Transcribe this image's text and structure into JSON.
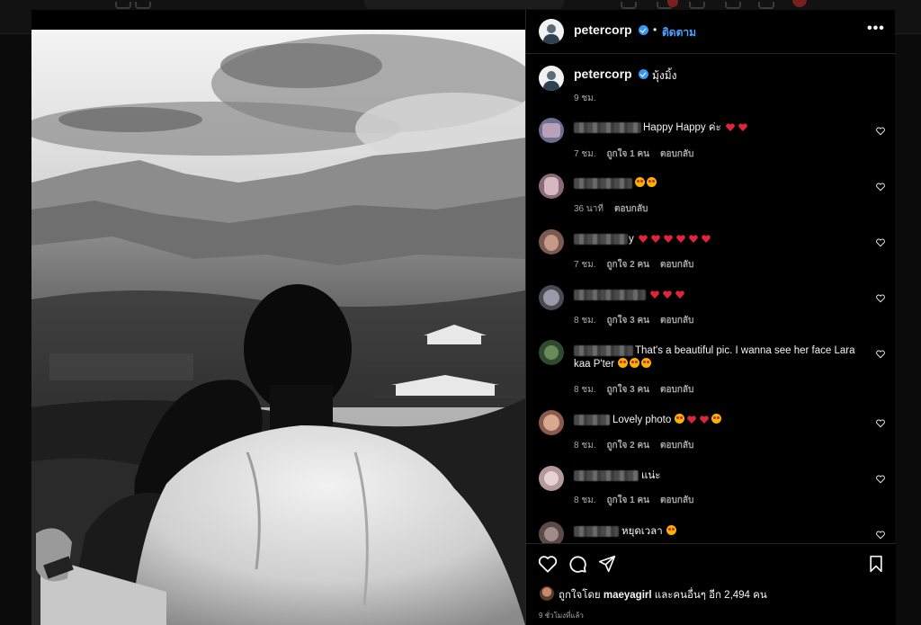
{
  "post": {
    "username": "petercorp",
    "dot": "•",
    "follow_label": "ติดตาม",
    "more_label": "•••",
    "caption": "มุ้งมิ้ง",
    "caption_time": "9 ชม."
  },
  "comments": [
    {
      "text": "Happy Happy ค่ะ",
      "emoji": "hearts2",
      "time": "7 ชม.",
      "likes": "ถูกใจ 1 คน",
      "reply": "ตอบกลับ"
    },
    {
      "text": "",
      "emoji": "faces2",
      "time": "36 นาที",
      "likes": "",
      "reply": "ตอบกลับ"
    },
    {
      "text": "y",
      "emoji": "hearts6",
      "time": "7 ชม.",
      "likes": "ถูกใจ 2 คน",
      "reply": "ตอบกลับ"
    },
    {
      "text": "",
      "emoji": "hearts3",
      "time": "8 ชม.",
      "likes": "ถูกใจ 3 คน",
      "reply": "ตอบกลับ"
    },
    {
      "text": "That's a beautiful pic. I wanna see her face Lara",
      "text2": "kaa P'ter",
      "emoji": "faces3",
      "time": "8 ชม.",
      "likes": "ถูกใจ 3 คน",
      "reply": "ตอบกลับ"
    },
    {
      "text": "Lovely photo",
      "emoji": "mixed",
      "time": "8 ชม.",
      "likes": "ถูกใจ 2 คน",
      "reply": "ตอบกลับ"
    },
    {
      "text": "แน่ะ",
      "emoji": "",
      "time": "8 ชม.",
      "likes": "ถูกใจ 1 คน",
      "reply": "ตอบกลับ"
    },
    {
      "text": "หยุดเวลา",
      "emoji": "face1",
      "time": "",
      "likes": "",
      "reply": ""
    }
  ],
  "footer": {
    "liked_by_prefix": "ถูกใจโดย",
    "liked_by_user": "maeyagirl",
    "liked_by_suffix": "และคนอื่นๆ อีก 2,494 คน",
    "time_ago": "9 ชั่วโมงที่แล้ว"
  },
  "icons": {
    "like": "heart-icon",
    "comment": "comment-icon",
    "share": "share-icon",
    "save": "bookmark-icon",
    "more": "more-options-icon"
  },
  "colors": {
    "accent": "#4aa3ff",
    "verified": "#3897f0",
    "heart": "#e0243a"
  }
}
